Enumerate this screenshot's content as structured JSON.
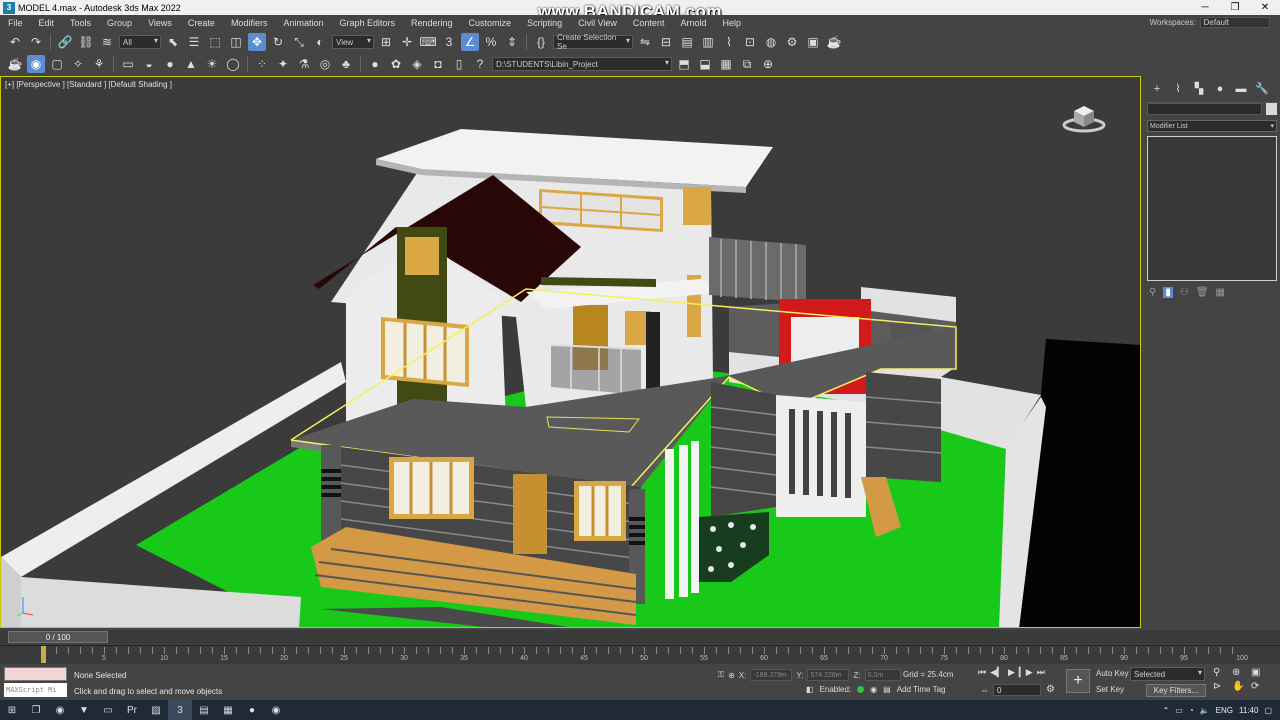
{
  "window": {
    "title": "MODEL 4.max - Autodesk 3ds Max 2022",
    "watermark": "www.BANDICAM.com",
    "icon": "3ds-max-app-icon"
  },
  "menu": {
    "items": [
      "File",
      "Edit",
      "Tools",
      "Group",
      "Views",
      "Create",
      "Modifiers",
      "Animation",
      "Graph Editors",
      "Rendering",
      "Customize",
      "Scripting",
      "Civil View",
      "Content",
      "Arnold",
      "Help"
    ],
    "workspace_label": "Workspaces:",
    "workspace_value": "Default"
  },
  "toolbar": {
    "selection_filter": "All",
    "ref_coord": "View",
    "named_selection": "Create Selection Se",
    "project_path": "D:\\STUDENTS\\Libin_Project"
  },
  "viewport": {
    "label": "[+] [Perspective ] [Standard ] [Default Shading ]"
  },
  "command_panel": {
    "modifier_list": "Modifier List"
  },
  "time_slider": {
    "frame": "0 / 100",
    "ticks": [
      "5",
      "10",
      "15",
      "20",
      "25",
      "30",
      "35",
      "40",
      "45",
      "50",
      "55",
      "60",
      "65",
      "70",
      "75",
      "80",
      "85",
      "90",
      "95",
      "100"
    ]
  },
  "status": {
    "maxscript_label": "MAXScript Mi",
    "selection": "None Selected",
    "prompt": "Click and drag to select and move objects",
    "x_label": "X:",
    "x_value": "-189.379m",
    "y_label": "Y:",
    "y_value": "574.226m",
    "z_label": "Z:",
    "z_value": "0.0m",
    "grid": "Grid = 25.4cm",
    "enabled_label": "Enabled:",
    "add_time_tag": "Add Time Tag",
    "current_frame": "0",
    "auto_key": "Auto Key",
    "set_key": "Set Key",
    "selected_mode": "Selected",
    "key_filters": "Key Filters..."
  },
  "taskbar": {
    "language": "ENG",
    "time": "11:40"
  },
  "colors": {
    "grass": "#19c919",
    "wall_white": "#e8e8e8",
    "roof_dark": "#2a0707",
    "frame_red": "#d21a1a",
    "wood": "#d49945",
    "selection_yellow": "#f4f05a"
  }
}
